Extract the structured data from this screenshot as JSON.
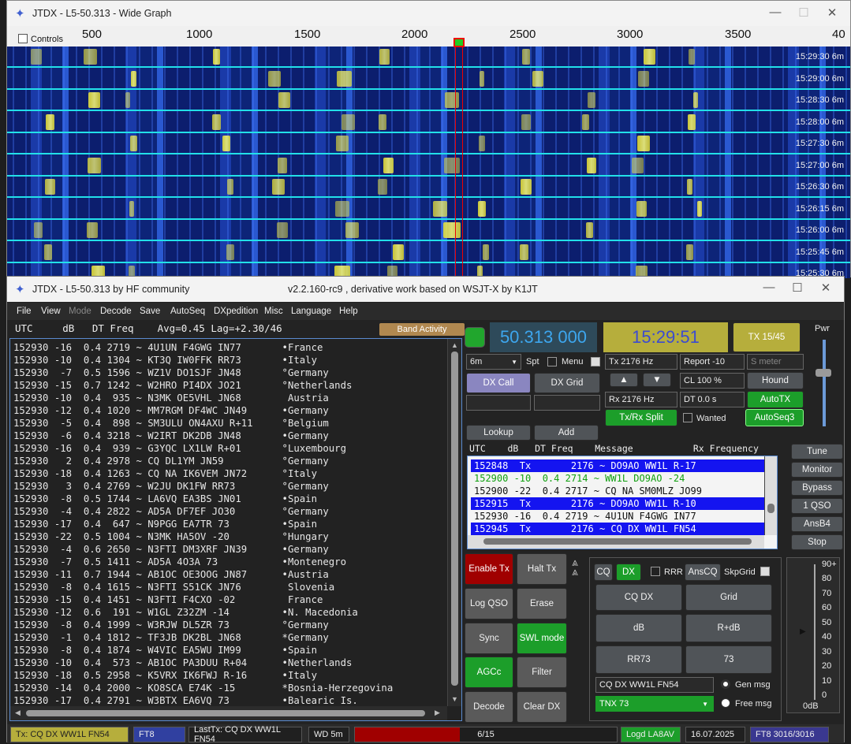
{
  "wide_graph": {
    "title": "JTDX - L5-50.313 - Wide Graph",
    "controls_label": "Controls",
    "scale_ticks": [
      "500",
      "1000",
      "1500",
      "2000",
      "2500",
      "3000",
      "3500",
      "40"
    ],
    "rows": [
      {
        "time": "15:29:30",
        "band": "6m"
      },
      {
        "time": "15:29:00",
        "band": "6m"
      },
      {
        "time": "15:28:30",
        "band": "6m"
      },
      {
        "time": "15:28:00",
        "band": "6m"
      },
      {
        "time": "15:27:30",
        "band": "6m"
      },
      {
        "time": "15:27:00",
        "band": "6m"
      },
      {
        "time": "15:26:30",
        "band": "6m"
      },
      {
        "time": "15:26:15",
        "band": "6m"
      },
      {
        "time": "15:26:00",
        "band": "6m"
      },
      {
        "time": "15:25:45",
        "band": "6m"
      },
      {
        "time": "15:25:30",
        "band": "6m"
      }
    ]
  },
  "main": {
    "title": "JTDX - L5-50.313  by HF community",
    "subtitle": "v2.2.160-rc9 , derivative work based on WSJT-X by K1JT"
  },
  "menu": [
    "File",
    "View",
    "Mode",
    "Decode",
    "Save",
    "AutoSeq",
    "DXpedition",
    "Misc",
    "Language",
    "Help"
  ],
  "band_activity": {
    "header": "UTC     dB   DT Freq    Avg=0.45 Lag=+2.30/46",
    "button": "Band Activity",
    "lines": [
      "152930 -16  0.4 2719 ~ 4U1UN F4GWG IN77       •France",
      "152930 -10  0.4 1304 ~ KT3Q IW0FFK RR73       •Italy",
      "152930  -7  0.5 1596 ~ WZ1V DO1SJF JN48       °Germany",
      "152930 -15  0.7 1242 ~ W2HRO PI4DX JO21       °Netherlands",
      "152930 -10  0.4  935 ~ N3MK OE5VHL JN68        Austria",
      "152930 -12  0.4 1020 ~ MM7RGM DF4WC JN49      •Germany",
      "152930  -5  0.4  898 ~ SM3ULU ON4AXU R+11     °Belgium",
      "152930  -6  0.4 3218 ~ W2IRT DK2DB JN48       •Germany",
      "152930 -16  0.4  939 ~ G3YQC LX1LW R+01       °Luxembourg",
      "152930   2  0.4 2978 ~ CQ DL1YM JN59          °Germany",
      "152930 -18  0.4 1263 ~ CQ NA IK6VEM JN72      °Italy",
      "152930   3  0.4 2769 ~ W2JU DK1FW RR73        °Germany",
      "152930  -8  0.5 1744 ~ LA6VQ EA3BS JN01       •Spain",
      "152930  -4  0.4 2822 ~ AD5A DF7EF JO30        °Germany",
      "152930 -17  0.4  647 ~ N9PGG EA7TR 73         •Spain",
      "152930 -22  0.5 1004 ~ N3MK HA5OV -20         °Hungary",
      "152930  -4  0.6 2650 ~ N3FTI DM3XRF JN39      •Germany",
      "152930  -7  0.5 1411 ~ AD5A 4O3A 73           •Montenegro",
      "152930 -11  0.7 1944 ~ AB1OC OE3OOG JN87      •Austria",
      "152930  -8  0.4 1615 ~ N3FTI S51CK JN76        Slovenia",
      "152930 -15  0.4 1451 ~ N3FTI F4CXO -02         France",
      "152930 -12  0.6  191 ~ W1GL Z32ZM -14         •N. Macedonia",
      "152930  -8  0.4 1999 ~ W3RJW DL5ZR 73         °Germany",
      "152930  -1  0.4 1812 ~ TF3JB DK2BL JN68       *Germany",
      "152930  -8  0.4 1874 ~ W4VIC EA5WU IM99       •Spain",
      "152930 -10  0.4  573 ~ AB1OC PA3DUU R+04      •Netherlands",
      "152930 -18  0.5 2958 ~ K5VRX IK6FWJ R-16      •Italy",
      "152930 -14  0.4 2000 ~ KO8SCA E74K -15        *Bosnia-Herzegovina",
      "152930 -17  0.4 2791 ~ W3BTX EA6VQ 73         •Balearic Is."
    ]
  },
  "top_controls": {
    "frequency": "50.313 000",
    "clock": "15:29:51",
    "tx_period": "TX 15/45",
    "pwr": "Pwr",
    "band": "6m",
    "spt": "Spt",
    "menu": "Menu",
    "dx_call": "DX Call",
    "dx_grid": "DX Grid",
    "tx_hz": "Tx  2176 Hz",
    "rx_hz": "Rx  2176 Hz",
    "report": "Report -10",
    "s_meter": "S meter",
    "cl": "CL  100 %",
    "hound": "Hound",
    "dt": "DT 0.0 s",
    "autotx": "AutoTX",
    "split": "Tx/Rx Split",
    "wanted": "Wanted",
    "autoseq3": "AutoSeq3",
    "lookup": "Lookup",
    "add": "Add"
  },
  "rx_frequency": {
    "header": "UTC    dB   DT Freq    Message           Rx Frequency",
    "lines": [
      {
        "text": "152848  Tx       2176 ~ DO9AO WW1L R-17",
        "style": "tx"
      },
      {
        "text": "152900 -10  0.4 2714 ~ WW1L DO9AO -24",
        "style": "green"
      },
      {
        "text": "152900 -22  0.4 2717 ~ CQ NA SM0MLZ JO99",
        "style": "plain"
      },
      {
        "text": "152915  Tx       2176 ~ DO9AO WW1L R-10",
        "style": "tx"
      },
      {
        "text": "152930 -16  0.4 2719 ~ 4U1UN F4GWG IN77",
        "style": "plain"
      },
      {
        "text": "152945  Tx       2176 ~ CQ DX WW1L FN54",
        "style": "tx"
      }
    ]
  },
  "side_buttons": [
    "Tune",
    "Monitor",
    "Bypass",
    "1 QSO",
    "AnsB4",
    "Stop"
  ],
  "action_buttons": {
    "enable_tx": "Enable Tx",
    "halt_tx": "Halt Tx",
    "log_qso": "Log QSO",
    "erase": "Erase",
    "sync": "Sync",
    "swl": "SWL mode",
    "agcc": "AGCc",
    "filter": "Filter",
    "decode": "Decode",
    "clear_dx": "Clear DX"
  },
  "msg_panel": {
    "cq": "CQ",
    "dx": "DX",
    "rrr": "RRR",
    "anscq": "AnsCQ",
    "skipgrid": "SkpGrid",
    "cq_dx": "CQ DX",
    "grid": "Grid",
    "db": "dB",
    "r_db": "R+dB",
    "rr73": "RR73",
    "m73": "73",
    "gen_msg_text": "CQ DX WW1L FN54",
    "gen_msg": "Gen msg",
    "free_text": "TNX 73",
    "free_msg": "Free msg"
  },
  "meter": {
    "ticks": [
      "90+",
      "80",
      "70",
      "60",
      "50",
      "40",
      "30",
      "20",
      "10",
      "0"
    ],
    "label": "0dB"
  },
  "status_bar": {
    "tx": "Tx: CQ DX WW1L FN54",
    "mode": "FT8",
    "last_tx": "LastTx: CQ DX WW1L FN54",
    "wd": "WD 5m",
    "progress": "6/15",
    "logd": "Logd LA8AV",
    "date": "16.07.2025",
    "mode_count": "FT8  3016/3016"
  },
  "progress_fraction": 0.4
}
